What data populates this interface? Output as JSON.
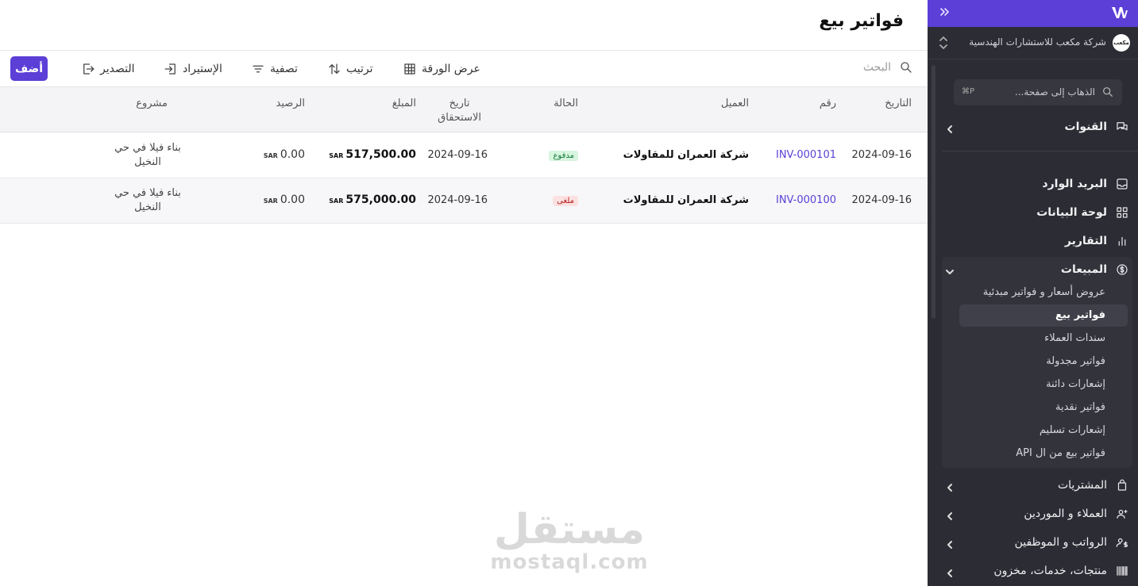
{
  "page": {
    "title": "فواتير بيع"
  },
  "toolbar": {
    "search_placeholder": "البحث",
    "sheet_view": "عرض الورقة",
    "sort": "ترتيب",
    "filter": "تصفية",
    "import": "الإستيراد",
    "export": "التصدير",
    "add": "أضف"
  },
  "table": {
    "columns": {
      "date": "التاريخ",
      "number": "رقم",
      "client": "العميل",
      "status": "الحالة",
      "due_line1": "تاريخ",
      "due_line2": "الاستحقاق",
      "amount": "المبلغ",
      "balance": "الرصيد",
      "project": "مشروع"
    },
    "currency": "SAR",
    "rows": [
      {
        "date": "2024-09-16",
        "number": "INV-000101",
        "client": "شركة العمران للمقاولات",
        "status": "مدفوع",
        "due": "2024-09-16",
        "amount": "517,500.00",
        "balance": "0.00",
        "project": "بناء فيلا في حي النخيل"
      },
      {
        "date": "2024-09-16",
        "number": "INV-000100",
        "client": "شركة العمران للمقاولات",
        "status": "ملغى",
        "due": "2024-09-16",
        "amount": "575,000.00",
        "balance": "0.00",
        "project": "بناء فيلا في حي النخيل"
      }
    ]
  },
  "watermark": {
    "arabic": "مستقل",
    "latin": "mostaql.com"
  },
  "sidebar": {
    "company_name": "شركة مكعب للاستشارات الهندسية",
    "company_avatar": "مكعب",
    "goto_label": "الذهاب إلى صفحة...",
    "goto_shortcut": "⌘P",
    "channels": "القنوات",
    "inbox": "البريد الوارد",
    "dashboard": "لوحة البيانات",
    "reports": "التقارير",
    "sales": "المبيعات",
    "sales_items": [
      "عروض أسعار و فواتير مبدئية",
      "فواتير بيع",
      "سندات العملاء",
      "فواتير مجدولة",
      "إشعارات دائنة",
      "فواتير نقدية",
      "إشعارات تسليم",
      "فواتير بيع من ال API"
    ],
    "purchases": "المشتريات",
    "clients_suppliers": "العملاء و الموردين",
    "payroll": "الرواتب و الموظفين",
    "products": "منتجات، خدمات، مخزون"
  },
  "colors": {
    "accent": "#5b3fd6",
    "sidebar_bg": "#2c2c34",
    "paid": "#127a38",
    "void": "#b81e1e"
  }
}
